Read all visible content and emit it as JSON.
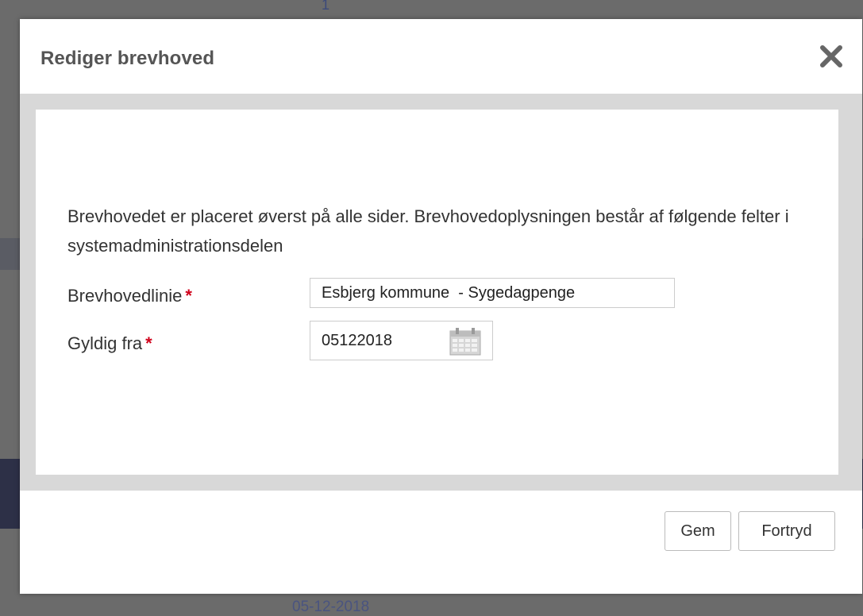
{
  "background": {
    "top_fragment": "1",
    "bottom_date": "05-12-2018"
  },
  "dialog": {
    "title": "Rediger brevhoved",
    "close_icon": "close-icon",
    "description": "Brevhovedet er placeret øverst på alle sider. Brevhovedoplysningen består af følgende felter i systemadministrationsdelen",
    "fields": {
      "header_line": {
        "label": "Brevhovedlinie",
        "required_marker": "*",
        "value": "Esbjerg kommune  - Sygedagpenge"
      },
      "valid_from": {
        "label": "Gyldig fra",
        "required_marker": "*",
        "value": "05122018",
        "icon": "calendar-icon"
      }
    },
    "buttons": {
      "save": "Gem",
      "cancel": "Fortryd"
    }
  },
  "colors": {
    "required": "#d0021b",
    "title": "#555555",
    "body_frame": "#d8d8d8"
  }
}
